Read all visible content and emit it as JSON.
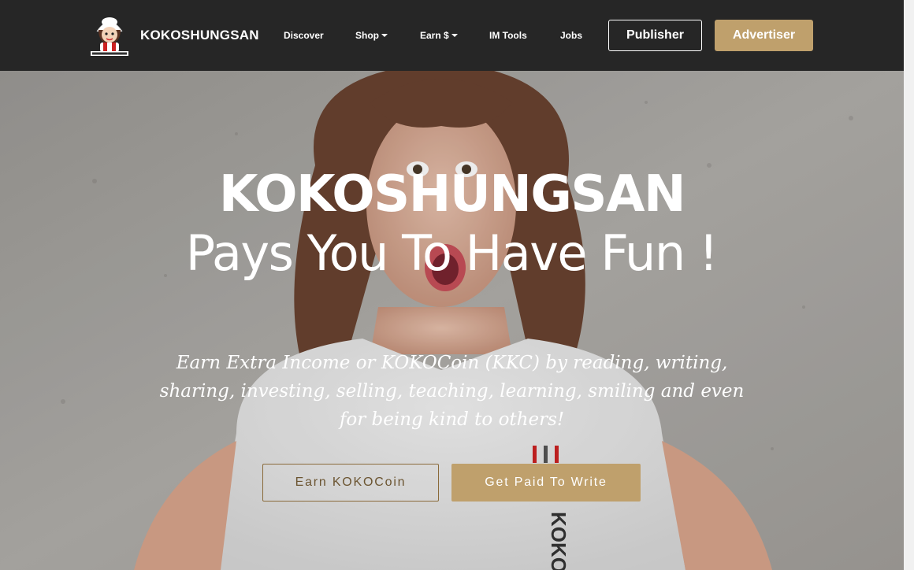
{
  "colors": {
    "navbar_bg": "#262626",
    "accent": "#bfa06c",
    "text_light": "#ffffff"
  },
  "brand": {
    "name": "KOKOSHUNGSAN",
    "logo_icon": "mascot-logo-icon"
  },
  "nav": {
    "items": [
      {
        "label": "Discover",
        "dropdown": false
      },
      {
        "label": "Shop",
        "dropdown": true
      },
      {
        "label": "Earn $",
        "dropdown": true
      },
      {
        "label": "IM Tools",
        "dropdown": false
      },
      {
        "label": "Jobs",
        "dropdown": false
      }
    ],
    "publisher_label": "Publisher",
    "advertiser_label": "Advertiser"
  },
  "hero": {
    "title": "KOKOSHUNGSAN",
    "subtitle": "Pays You To Have Fun !",
    "text": "Earn Extra Income or KOKOCoin (KKC) by reading, writing, sharing, investing, selling, teaching, learning, smiling and even for being kind to others!",
    "earn_button": "Earn KOKOCoin",
    "write_button": "Get Paid To Write",
    "background": "photo of surprised woman with curly brown hair in white t-shirt against concrete wall"
  }
}
